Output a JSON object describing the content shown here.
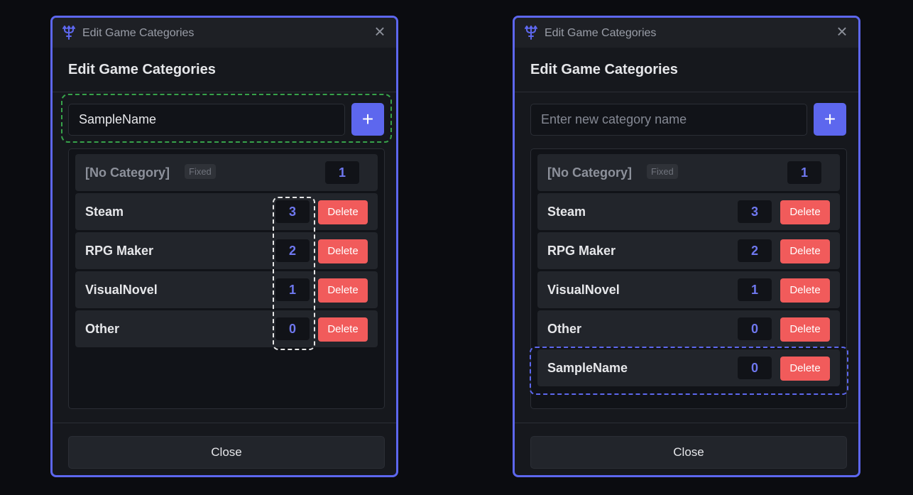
{
  "colors": {
    "accent": "#5d67ee",
    "delete": "#f15b5b",
    "count_text": "#6f78f0",
    "highlight_input": "#37a24a",
    "highlight_counts": "#e6e6e6",
    "highlight_new_row": "#5d67ee"
  },
  "icons": {
    "app": "trident-icon",
    "close": "close-icon",
    "add": "plus-icon"
  },
  "left": {
    "window_title": "Edit Game Categories",
    "dialog_title": "Edit Game Categories",
    "input_value": "SampleName",
    "input_placeholder": "Enter new category name",
    "add_label": "+",
    "fixed_row": {
      "name": "[No Category]",
      "badge": "Fixed",
      "count": "1"
    },
    "rows": [
      {
        "name": "Steam",
        "count": "3",
        "delete": "Delete"
      },
      {
        "name": "RPG Maker",
        "count": "2",
        "delete": "Delete"
      },
      {
        "name": "VisualNovel",
        "count": "1",
        "delete": "Delete"
      },
      {
        "name": "Other",
        "count": "0",
        "delete": "Delete"
      }
    ],
    "close_label": "Close"
  },
  "right": {
    "window_title": "Edit Game Categories",
    "dialog_title": "Edit Game Categories",
    "input_value": "",
    "input_placeholder": "Enter new category name",
    "add_label": "+",
    "fixed_row": {
      "name": "[No Category]",
      "badge": "Fixed",
      "count": "1"
    },
    "rows": [
      {
        "name": "Steam",
        "count": "3",
        "delete": "Delete"
      },
      {
        "name": "RPG Maker",
        "count": "2",
        "delete": "Delete"
      },
      {
        "name": "VisualNovel",
        "count": "1",
        "delete": "Delete"
      },
      {
        "name": "Other",
        "count": "0",
        "delete": "Delete"
      },
      {
        "name": "SampleName",
        "count": "0",
        "delete": "Delete"
      }
    ],
    "close_label": "Close"
  }
}
